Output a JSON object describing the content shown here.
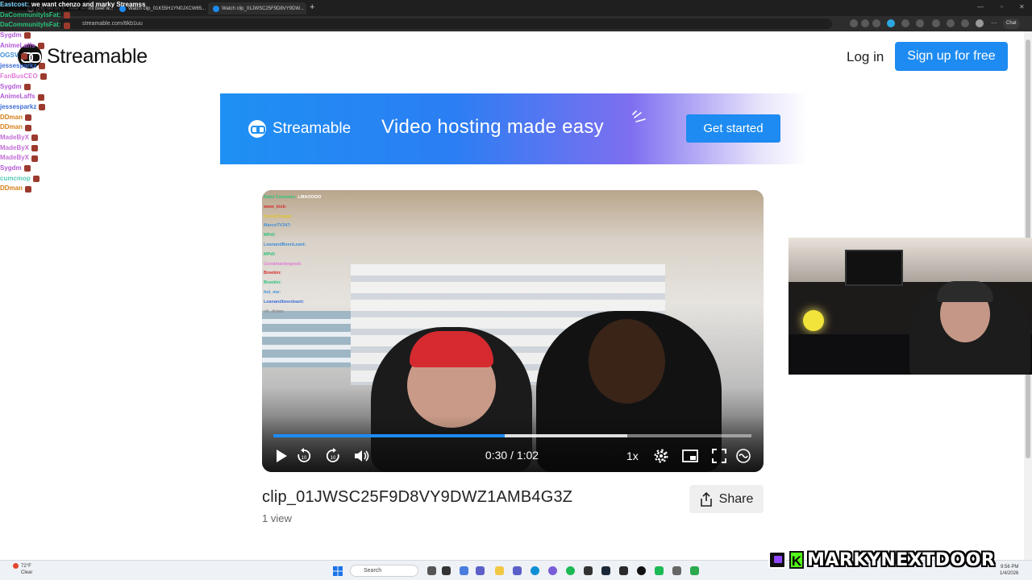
{
  "browser": {
    "tabs": [
      {
        "label": "(28) red on X: \"After recent beef w..."
      },
      {
        "label": "Watch clip_01K55H1YN0JXCW65..."
      },
      {
        "label": "Watch clip_01JWSC25F9D8VY9DW..."
      }
    ],
    "url": "streamable.com/8kb1uu",
    "chat_button": "Chat"
  },
  "site": {
    "brand": "Streamable",
    "login_label": "Log in",
    "signup_label": "Sign up for free"
  },
  "banner": {
    "brand": "Streamable",
    "tagline": "Video hosting made easy",
    "cta": "Get started"
  },
  "player": {
    "time": "0:30 / 1:02",
    "progress": 0.484,
    "buffered": 0.74,
    "speed": "1x"
  },
  "clip": {
    "title": "clip_01JWSC25F9D8VY9DWZ1AMB4G3Z",
    "views": "1 view",
    "share_label": "Share"
  },
  "stream_chat": {
    "header_user": "Eastcost:",
    "header_message": "we want chenzo and marky Streamss",
    "rows": [
      {
        "user": "DaCommunityIsFat:",
        "color": "#29c27a"
      },
      {
        "user": "DaCommunityIsFat:",
        "color": "#29c27a"
      },
      {
        "user": "Sygdm",
        "color": "#b45ad6"
      },
      {
        "user": "AnimeLaffs",
        "color": "#b45ad6"
      },
      {
        "user": "OGSV",
        "color": "#3d8fd6"
      },
      {
        "user": "jessesparkz",
        "color": "#3d6ed6"
      },
      {
        "user": "FanBusCEO",
        "color": "#e07bd8"
      },
      {
        "user": "Sygdm",
        "color": "#b45ad6"
      },
      {
        "user": "AnimeLaffs",
        "color": "#b45ad6"
      },
      {
        "user": "jessesparkz",
        "color": "#3d6ed6"
      },
      {
        "user": "DDman",
        "color": "#d67f1a"
      },
      {
        "user": "DDman",
        "color": "#d67f1a"
      },
      {
        "user": "MadeByX",
        "color": "#c46fd6"
      },
      {
        "user": "MadeByX",
        "color": "#c46fd6"
      },
      {
        "user": "MadeByX",
        "color": "#c46fd6"
      },
      {
        "user": "Sygdm",
        "color": "#b45ad6"
      },
      {
        "user": "cumcmop",
        "color": "#57c9b4"
      },
      {
        "user": "DDman",
        "color": "#d67f1a"
      }
    ]
  },
  "video_chat": {
    "rows": [
      {
        "user": "Ralst Customs:",
        "text": "LMAOOOO",
        "color": "#29c27a"
      },
      {
        "user": "www_kick:",
        "text": "",
        "color": "#d62a2a"
      },
      {
        "user": "NoodyDoggy:",
        "text": "",
        "color": "#e0c22d"
      },
      {
        "user": "MarcoTV347:",
        "text": "",
        "color": "#3d8fd6"
      },
      {
        "user": "MPdl:",
        "text": "",
        "color": "#29c27a"
      },
      {
        "user": "LeanandBeenLeant:",
        "text": "",
        "color": "#3d8fd6"
      },
      {
        "user": "MPdl:",
        "text": "",
        "color": "#29c27a"
      },
      {
        "user": "Goodmanbegood:",
        "text": "",
        "color": "#e07bd8"
      },
      {
        "user": "Breekin:",
        "text": "",
        "color": "#d62a2a"
      },
      {
        "user": "Breekin:",
        "text": "",
        "color": "#29c27a"
      },
      {
        "user": "hoi_me:",
        "text": "",
        "color": "#3d8fd6"
      },
      {
        "user": "Leanandbeenleant:",
        "text": "",
        "color": "#3d6ed6"
      },
      {
        "user": "uh_dylan:",
        "text": "",
        "color": "#8a8a8a"
      }
    ]
  },
  "taskbar": {
    "weather_temp": "72°F",
    "weather_desc": "Clear",
    "search_placeholder": "Search",
    "time": "9:56 PM",
    "date": "1/4/2026"
  },
  "streamer": {
    "name": "MARKYNEXTDOOR",
    "kick_letter": "K"
  },
  "colors": {
    "accent": "#1d8bf1",
    "browser_dark": "#1f1f1f"
  }
}
